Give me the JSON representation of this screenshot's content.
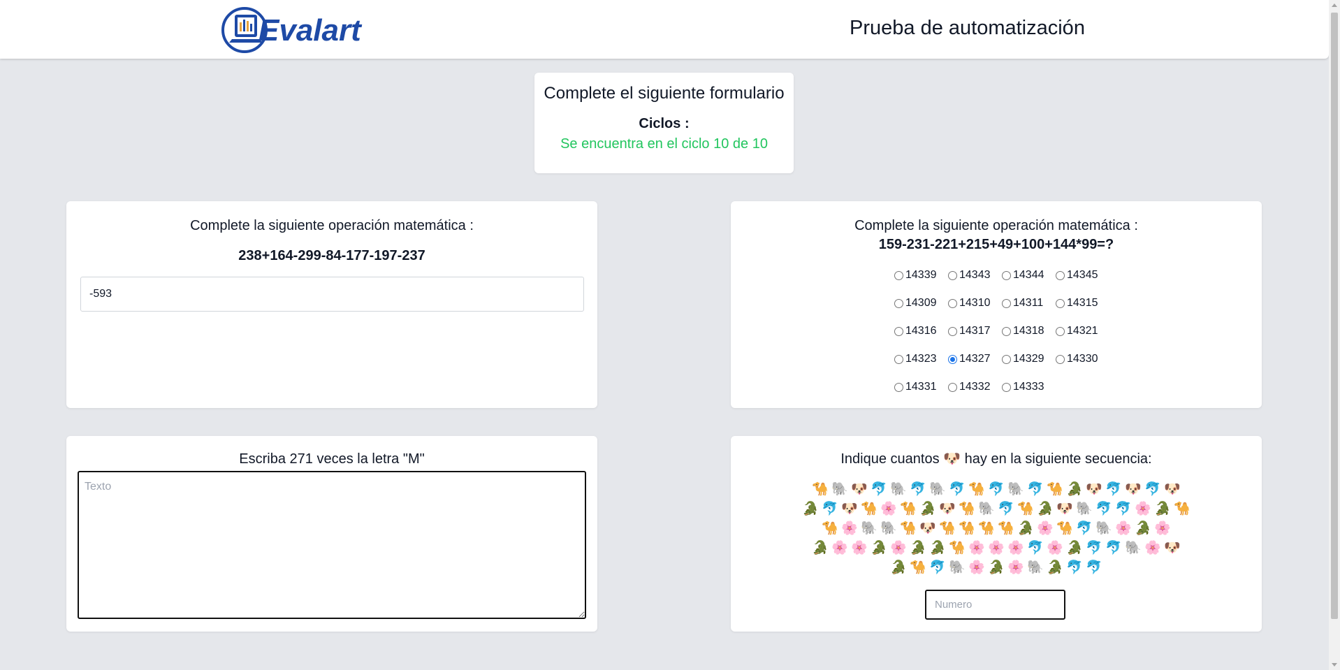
{
  "header": {
    "logo_text": "Evalart",
    "title": "Prueba de automatización"
  },
  "intro": {
    "title": "Complete el siguiente formulario",
    "cycles_label": "Ciclos :",
    "cycles_text": "Se encuentra en el ciclo 10 de 10",
    "cycles_color": "#22c55e"
  },
  "math_input": {
    "heading": "Complete la siguiente operación matemática :",
    "expression": "238+164-299-84-177-197-237",
    "value": "-593"
  },
  "math_radio": {
    "heading": "Complete la siguiente operación matemática :",
    "expression": "159-231-221+215+49+100+144*99=?",
    "selected": "14327",
    "rows": [
      [
        "14339",
        "14343",
        "14344",
        "14345"
      ],
      [
        "14309",
        "14310",
        "14311",
        "14315"
      ],
      [
        "14316",
        "14317",
        "14318",
        "14321"
      ],
      [
        "14323",
        "14327",
        "14329",
        "14330"
      ],
      [
        "14331",
        "14332",
        "14333"
      ]
    ]
  },
  "letters": {
    "heading": "Escriba 271 veces la letra \"M\"",
    "placeholder": "Texto",
    "value": ""
  },
  "count": {
    "heading_before": "Indique cuantos",
    "heading_target": "🐶",
    "heading_after": "hay en la siguiente secuencia:",
    "placeholder": "Numero",
    "icon_names": {
      "🐪": "camel-icon",
      "🐘": "elephant-icon",
      "🐶": "dog-icon",
      "🐬": "dolphin-icon",
      "🐊": "crocodile-icon",
      "🌸": "flower-icon"
    },
    "rows": [
      [
        "🐪",
        "🐘",
        "🐶",
        "🐬",
        "🐘",
        "🐬",
        "🐘",
        "🐬",
        "🐪",
        "🐬",
        "🐘",
        "🐬",
        "🐪",
        "🐊",
        "🐶",
        "🐬",
        "🐶",
        "🐬",
        "🐶"
      ],
      [
        "🐊",
        "🐬",
        "🐶",
        "🐪",
        "🌸",
        "🐪",
        "🐊",
        "🐶",
        "🐪",
        "🐘",
        "🐬",
        "🐪",
        "🐊",
        "🐶",
        "🐘",
        "🐬",
        "🐬",
        "🌸",
        "🐊",
        "🐪"
      ],
      [
        "🐪",
        "🌸",
        "🐘",
        "🐘",
        "🐪",
        "🐶",
        "🐪",
        "🐪",
        "🐪",
        "🐪",
        "🐊",
        "🌸",
        "🐪",
        "🐬",
        "🐘",
        "🌸",
        "🐊",
        "🌸"
      ],
      [
        "🐊",
        "🌸",
        "🌸",
        "🐊",
        "🌸",
        "🐊",
        "🐊",
        "🐪",
        "🌸",
        "🌸",
        "🌸",
        "🐬",
        "🌸",
        "🐊",
        "🐬",
        "🐬",
        "🐘",
        "🌸",
        "🐶"
      ],
      [
        "🐊",
        "🐪",
        "🐬",
        "🐘",
        "🌸",
        "🐊",
        "🌸",
        "🐘",
        "🐊",
        "🐬",
        "🐬"
      ]
    ]
  }
}
